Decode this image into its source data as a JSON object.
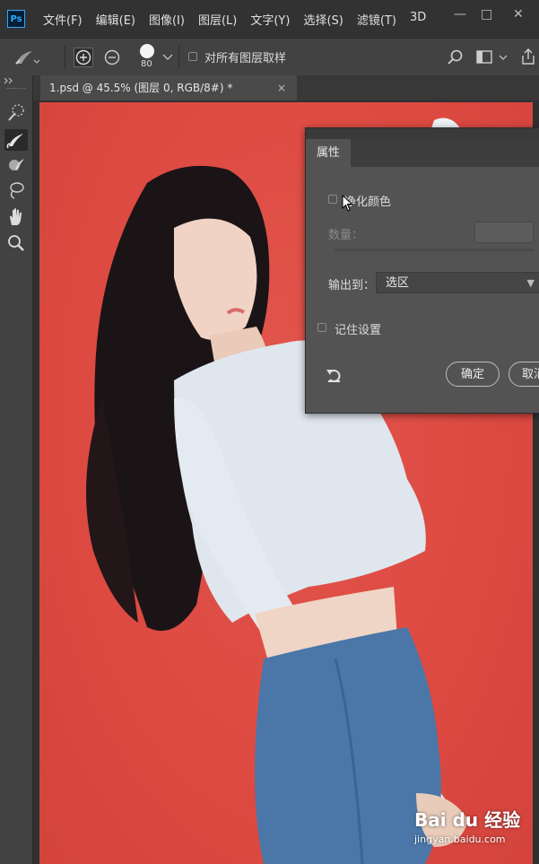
{
  "app": {
    "logo": "Ps"
  },
  "menu": [
    "文件(F)",
    "编辑(E)",
    "图像(I)",
    "图层(L)",
    "文字(Y)",
    "选择(S)",
    "滤镜(T)",
    "3D"
  ],
  "window_controls": {
    "minimize": "—",
    "restore": "□",
    "close": "✕"
  },
  "options": {
    "brush_size": "80",
    "sample_all_layers": "对所有图层取样"
  },
  "document_tab": {
    "title": "1.psd @ 45.5% (图层 0, RGB/8#) *",
    "close": "×"
  },
  "properties": {
    "tab": "属性",
    "decontaminate_label": "净化颜色",
    "amount_label": "数量：",
    "output_to_label": "输出到：",
    "output_to_value": "选区",
    "remember_label": "记住设置",
    "ok_label": "确定",
    "cancel_label": "取消"
  },
  "watermark": {
    "logo": "Bai du 经验",
    "url": "jingyan.baidu.com"
  },
  "colors": {
    "canvas_red": "#dd4a42",
    "ps_blue": "#31a8ff",
    "panel": "#535353"
  }
}
